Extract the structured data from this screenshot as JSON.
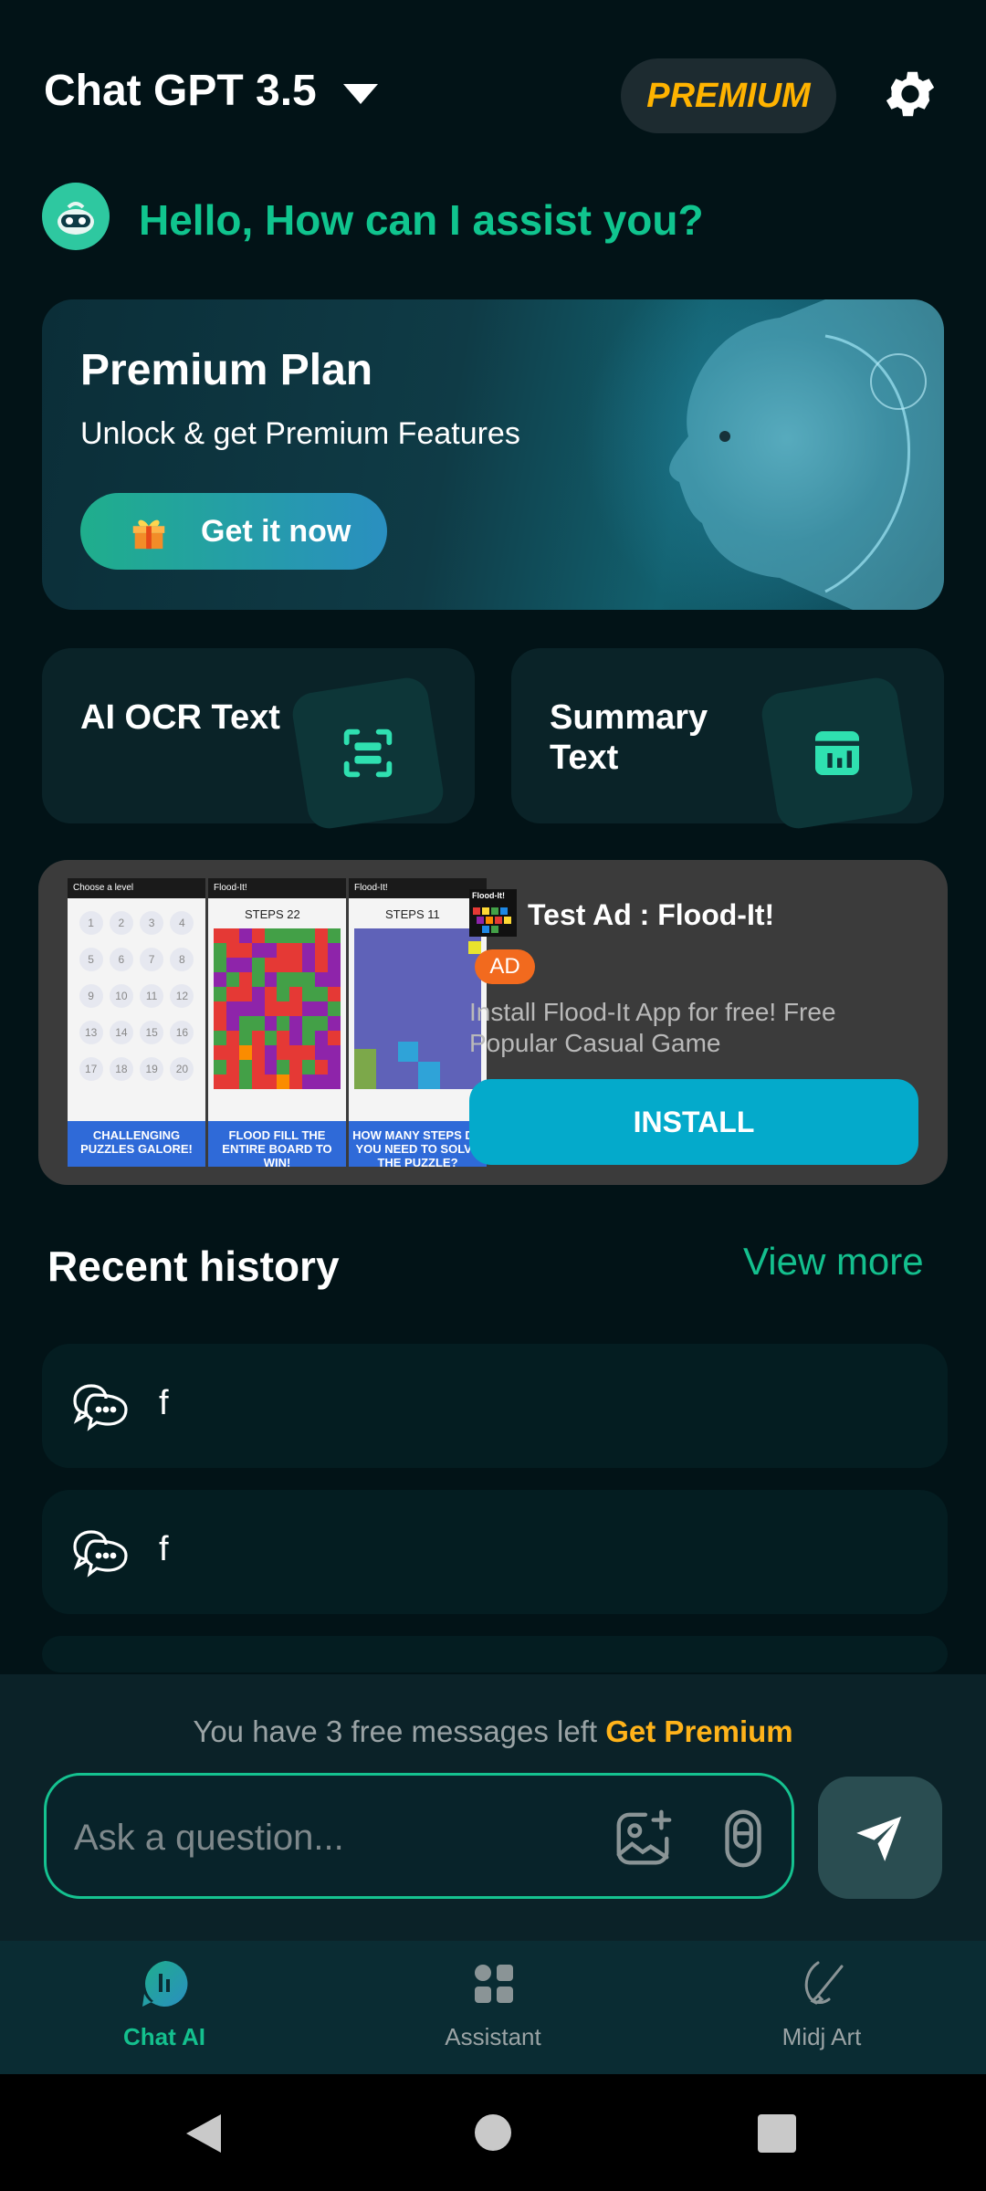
{
  "header": {
    "title": "Chat GPT 3.5",
    "premium_label": "PREMIUM"
  },
  "greeting": "Hello, How can I assist you?",
  "banner": {
    "title": "Premium Plan",
    "subtitle": "Unlock & get Premium Features",
    "button_label": "Get it now"
  },
  "features": [
    {
      "title": "AI OCR Text",
      "icon": "scan-text-icon"
    },
    {
      "title": "Summary Text",
      "icon": "summary-chart-icon"
    }
  ],
  "ad": {
    "title": "Test Ad : Flood-It!",
    "badge": "AD",
    "description": "Install Flood-It App for free! Free Popular Casual Game",
    "install_label": "INSTALL",
    "icon_text": "Flood-It!",
    "screens": [
      {
        "bar": "Choose a level",
        "caption": "CHALLENGING PUZZLES GALORE!"
      },
      {
        "bar": "Flood-It!",
        "steps": "STEPS 22",
        "caption": "FLOOD FILL THE ENTIRE BOARD TO WIN!"
      },
      {
        "bar": "Flood-It!",
        "steps": "STEPS 11",
        "caption": "HOW MANY STEPS DO YOU NEED TO SOLVE THE PUZZLE?"
      }
    ]
  },
  "recent": {
    "title": "Recent history",
    "view_more": "View more",
    "items": [
      {
        "text": "f"
      },
      {
        "text": "f"
      }
    ]
  },
  "composer": {
    "free_messages_text": "You have 3 free messages left",
    "get_premium": "Get Premium",
    "placeholder": "Ask a question..."
  },
  "nav": {
    "items": [
      {
        "label": "Chat AI",
        "active": true
      },
      {
        "label": "Assistant",
        "active": false
      },
      {
        "label": "Midj Art",
        "active": false
      }
    ]
  },
  "colors": {
    "accent": "#14c08e",
    "premium": "#ffb300",
    "background": "#021317",
    "install": "#04aacb"
  }
}
